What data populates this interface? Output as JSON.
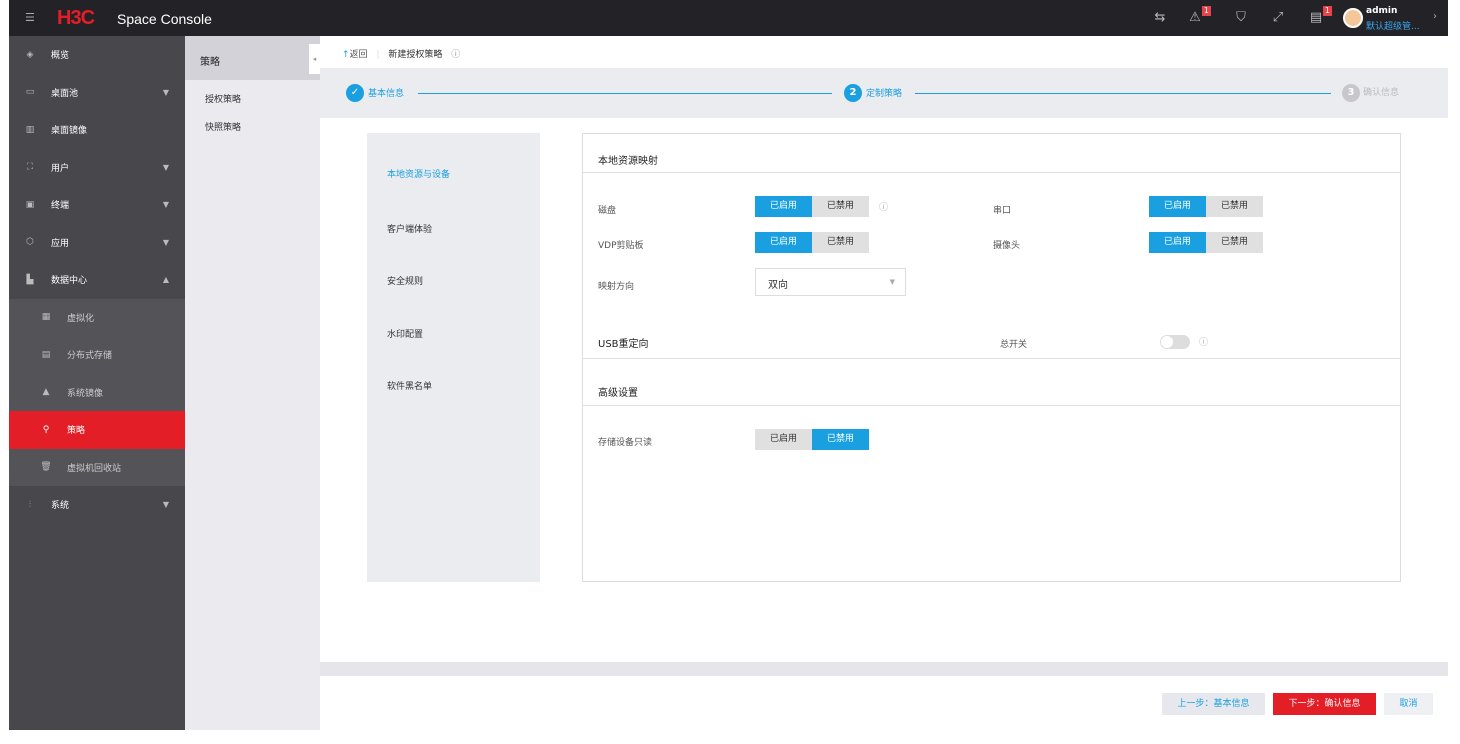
{
  "header": {
    "logo": "H3C",
    "product": "Space Console",
    "badges": {
      "alarm": "1",
      "task": "1"
    },
    "user": "admin",
    "role": "默认超级管..."
  },
  "sidebar": {
    "items": [
      {
        "label": "概览",
        "icon": "layers-icon"
      },
      {
        "label": "桌面池",
        "icon": "desktop-pool-icon",
        "arrow": "▼"
      },
      {
        "label": "桌面镜像",
        "icon": "image-icon"
      },
      {
        "label": "用户",
        "icon": "user-icon",
        "arrow": "▼"
      },
      {
        "label": "终端",
        "icon": "terminal-icon",
        "arrow": "▼"
      },
      {
        "label": "应用",
        "icon": "app-icon",
        "arrow": "▼"
      },
      {
        "label": "数据中心",
        "icon": "datacenter-icon",
        "arrow": "▲"
      },
      {
        "label": "虚拟化",
        "icon": "virtualization-icon"
      },
      {
        "label": "分布式存储",
        "icon": "storage-icon"
      },
      {
        "label": "系统镜像",
        "icon": "system-image-icon"
      },
      {
        "label": "策略",
        "icon": "policy-icon"
      },
      {
        "label": "虚拟机回收站",
        "icon": "trash-icon"
      },
      {
        "label": "系统",
        "icon": "settings-sliders-icon",
        "arrow": "▼"
      }
    ]
  },
  "subnav": {
    "title": "策略",
    "items": [
      "授权策略",
      "快照策略"
    ]
  },
  "breadcrumb": {
    "back": "返回",
    "title": "新建授权策略"
  },
  "steps": [
    {
      "num": "✓",
      "label": "基本信息"
    },
    {
      "num": "2",
      "label": "定制策略"
    },
    {
      "num": "3",
      "label": "确认信息"
    }
  ],
  "tabs": [
    "本地资源与设备",
    "客户端体验",
    "安全规则",
    "水印配置",
    "软件黑名单"
  ],
  "form": {
    "section1": "本地资源映射",
    "enable": "已启用",
    "disable": "已禁用",
    "disk": "磁盘",
    "serial": "串口",
    "clipboard": "VDP剪贴板",
    "camera": "摄像头",
    "direction_label": "映射方向",
    "direction_value": "双向",
    "section2": "USB重定向",
    "master_switch": "总开关",
    "master_switch_on": false,
    "section3": "高级设置",
    "storage_readonly": "存储设备只读"
  },
  "footer": {
    "prev": "上一步：基本信息",
    "next": "下一步：确认信息",
    "cancel": "取消"
  }
}
